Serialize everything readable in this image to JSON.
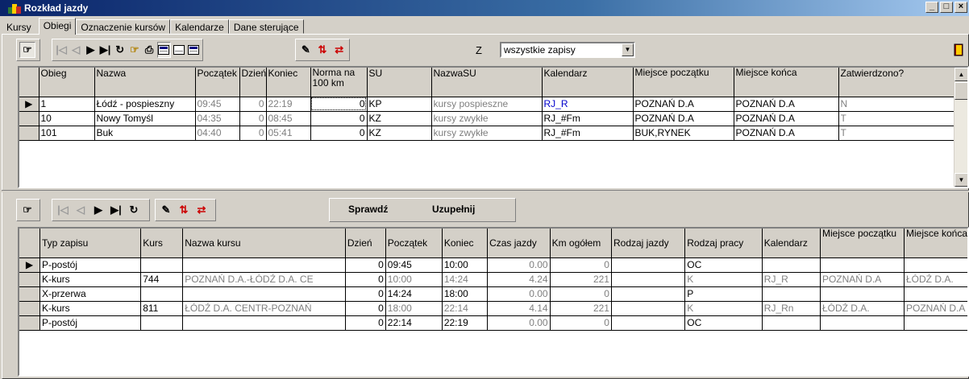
{
  "window": {
    "title": "Rozkład jazdy",
    "buttons": [
      "_",
      "□",
      "×"
    ]
  },
  "tabs": [
    {
      "label": "Kursy",
      "active": false
    },
    {
      "label": "Obiegi",
      "active": true
    },
    {
      "label": "Oznaczenie kursów",
      "active": false
    },
    {
      "label": "Kalendarze",
      "active": false
    },
    {
      "label": "Dane sterujące",
      "active": false
    }
  ],
  "filter": {
    "label": "Z",
    "value": "wszystkie zapisy"
  },
  "top_grid": {
    "columns": [
      "Obieg",
      "Nazwa",
      "Początek",
      "Dzień",
      "Koniec",
      "Norma na 100 km",
      "SU",
      "NazwaSU",
      "Kalendarz",
      "Miejsce początku",
      "Miejsce końca",
      "Zatwierdzono?"
    ],
    "rows": [
      {
        "current": true,
        "cells": [
          "1",
          "Łódź - pospieszny",
          "09:45",
          "0",
          "22:19",
          "0",
          "KP",
          "kursy pospieszne",
          "RJ_R",
          "POZNAŃ D.A",
          "POZNAŃ D.A",
          "N"
        ]
      },
      {
        "current": false,
        "cells": [
          "10",
          "Nowy Tomyśl",
          "04:35",
          "0",
          "08:45",
          "0",
          "KZ",
          "kursy zwykłe",
          "RJ_#Fm",
          "POZNAŃ D.A",
          "POZNAŃ D.A",
          "T"
        ]
      },
      {
        "current": false,
        "cells": [
          "101",
          "Buk",
          "04:40",
          "0",
          "05:41",
          "0",
          "KZ",
          "kursy zwykłe",
          "RJ_#Fm",
          "BUK,RYNEK",
          "POZNAŃ D.A",
          "T"
        ]
      }
    ]
  },
  "actions": {
    "check": "Sprawdź",
    "fill": "Uzupełnij"
  },
  "bottom_grid": {
    "columns": [
      "Typ zapisu",
      "Kurs",
      "Nazwa kursu",
      "Dzień",
      "Początek",
      "Koniec",
      "Czas jazdy",
      "Km ogółem",
      "Rodzaj jazdy",
      "Rodzaj pracy",
      "Kalendarz",
      "Miejsce początku",
      "Miejsce końca"
    ],
    "rows": [
      {
        "current": true,
        "cells": [
          "P-postój",
          "",
          "",
          "0",
          "09:45",
          "10:00",
          "0.00",
          "0",
          "",
          "OC",
          "",
          "",
          ""
        ]
      },
      {
        "current": false,
        "cells": [
          "K-kurs",
          "744",
          "POZNAŃ D.A.-ŁÓDŹ D.A. CE",
          "0",
          "10:00",
          "14:24",
          "4.24",
          "221",
          "",
          "K",
          "RJ_R",
          "POZNAŃ D.A",
          "ŁÓDŹ D.A."
        ]
      },
      {
        "current": false,
        "cells": [
          "X-przerwa",
          "",
          "",
          "0",
          "14:24",
          "18:00",
          "0.00",
          "0",
          "",
          "P",
          "",
          "",
          ""
        ]
      },
      {
        "current": false,
        "cells": [
          "K-kurs",
          "811",
          "ŁÓDŹ D.A. CENTR-POZNAŃ",
          "0",
          "18:00",
          "22:14",
          "4.14",
          "221",
          "",
          "K",
          "RJ_Rn",
          "ŁÓDŹ D.A.",
          "POZNAŃ D.A"
        ]
      },
      {
        "current": false,
        "cells": [
          "P-postój",
          "",
          "",
          "0",
          "22:14",
          "22:19",
          "0.00",
          "0",
          "",
          "OC",
          "",
          "",
          ""
        ]
      }
    ]
  },
  "colors": {
    "title_start": "#0a246a",
    "title_end": "#a6caf0",
    "face": "#d4d0c8",
    "link_blue": "#0000cc"
  },
  "icons": [
    "hand-pointer-icon",
    "first-icon",
    "prev-icon",
    "next-icon",
    "last-icon",
    "refresh-icon",
    "print-icon",
    "grid-view-icon",
    "exit-door-icon"
  ]
}
